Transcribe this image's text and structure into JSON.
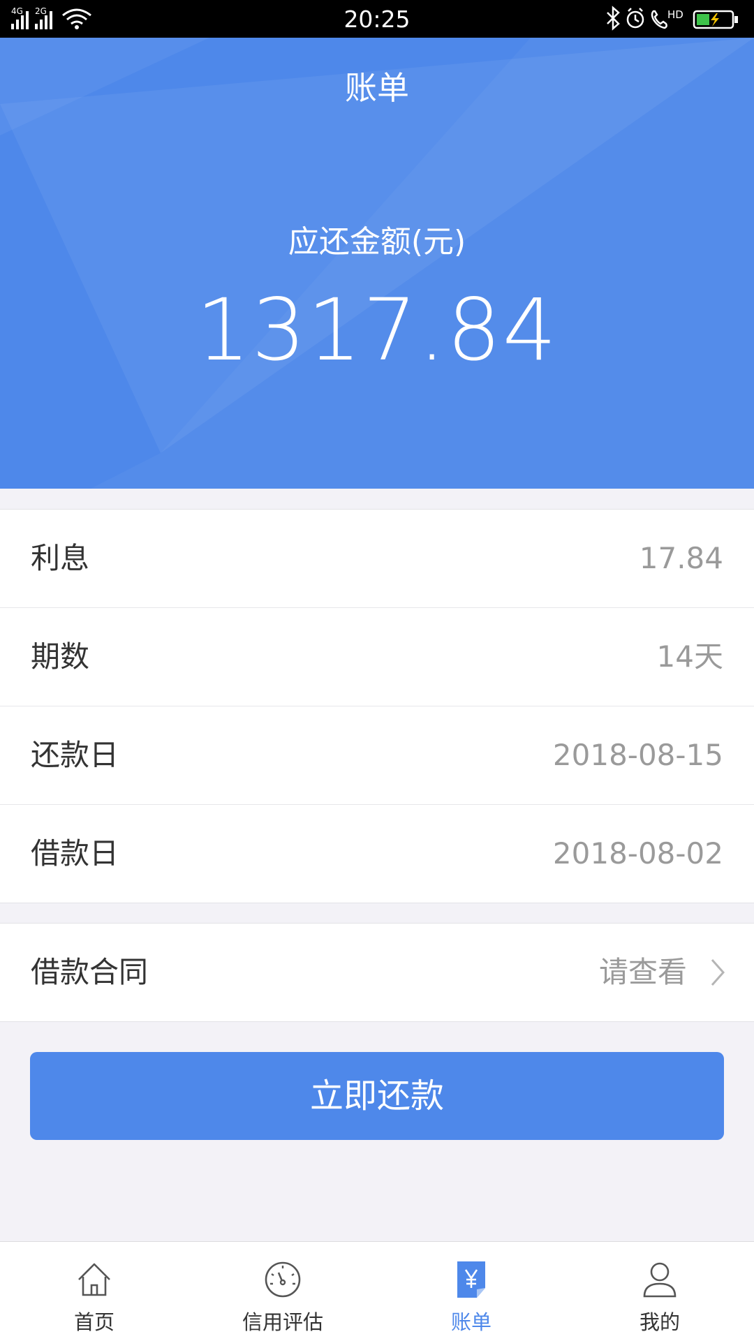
{
  "status_bar": {
    "time": "20:25",
    "network_1": "4G",
    "network_2": "2G",
    "extra": "HD"
  },
  "header": {
    "title": "账单"
  },
  "summary": {
    "label": "应还金额(元)",
    "amount": "1317.84"
  },
  "details": [
    {
      "label": "利息",
      "value": "17.84"
    },
    {
      "label": "期数",
      "value": "14天"
    },
    {
      "label": "还款日",
      "value": "2018-08-15"
    },
    {
      "label": "借款日",
      "value": "2018-08-02"
    }
  ],
  "contract": {
    "label": "借款合同",
    "value": "请查看"
  },
  "pay_button": {
    "label": "立即还款"
  },
  "tabs": [
    {
      "label": "首页",
      "icon": "home-icon"
    },
    {
      "label": "信用评估",
      "icon": "gauge-icon"
    },
    {
      "label": "账单",
      "icon": "bill-icon",
      "active": true
    },
    {
      "label": "我的",
      "icon": "user-icon"
    }
  ],
  "colors": {
    "primary": "#4e88ea",
    "background": "#f3f2f7",
    "text": "#333333",
    "muted": "#9a9a9a"
  }
}
